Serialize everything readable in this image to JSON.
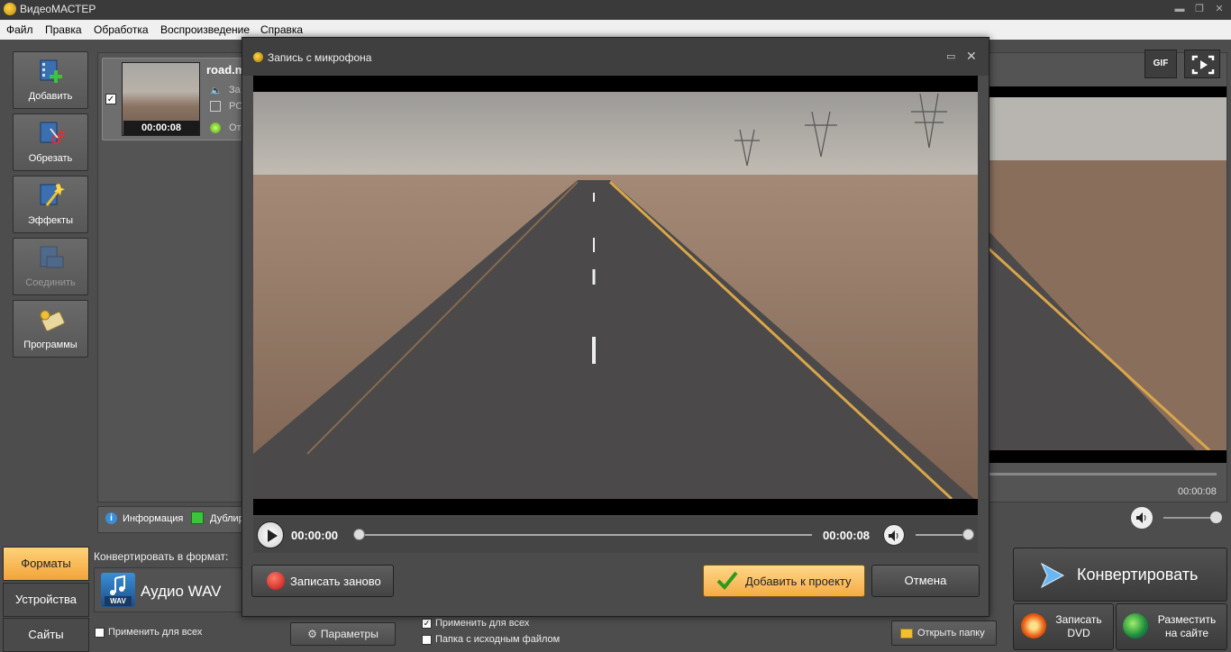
{
  "window": {
    "title": "ВидеоМАСТЕР"
  },
  "menu": [
    "Файл",
    "Правка",
    "Обработка",
    "Воспроизведение",
    "Справка"
  ],
  "toolbar": {
    "add": "Добавить",
    "trim": "Обрезать",
    "effects": "Эффекты",
    "join": "Соединить",
    "programs": "Программы"
  },
  "file": {
    "name": "road.m",
    "meta_audio": "За",
    "meta_video": "PC",
    "meta_status": "От",
    "duration": "00:00:08",
    "checked": true
  },
  "info_tabs": {
    "info": "Информация",
    "duplicate": "Дублир"
  },
  "preview": {
    "gif_label": "GIF",
    "time": "00:00:08"
  },
  "bottom": {
    "tabs": [
      "Форматы",
      "Устройства",
      "Сайты"
    ],
    "active_tab": "Форматы",
    "convert_to_label": "Конвертировать в формат:",
    "format_name": "Аудио WAV",
    "format_tag": "WAV",
    "apply_all_left": "Применить для всех",
    "params_label": "Параметры",
    "apply_all_right": "Применить для всех",
    "source_folder": "Папка с исходным файлом",
    "open_folder": "Открыть папку"
  },
  "actions": {
    "convert": "Конвертировать",
    "burn_dvd_line1": "Записать",
    "burn_dvd_line2": "DVD",
    "publish_line1": "Разместить",
    "publish_line2": "на сайте"
  },
  "dialog": {
    "title": "Запись с микрофона",
    "time_start": "00:00:00",
    "time_end": "00:00:08",
    "rerecord": "Записать заново",
    "add_to_project": "Добавить к проекту",
    "cancel": "Отмена"
  },
  "colors": {
    "accent": "#f6ab45",
    "record_red": "#c01010",
    "bg": "#4d4d4d"
  }
}
